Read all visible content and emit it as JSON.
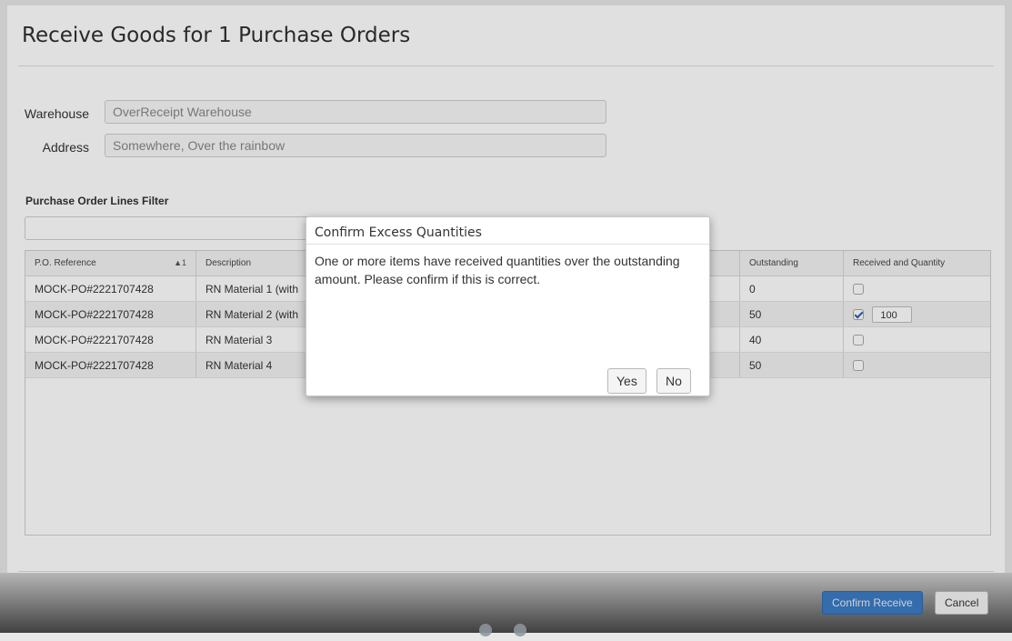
{
  "page": {
    "title": "Receive Goods for 1 Purchase Orders"
  },
  "form": {
    "warehouse_label": "Warehouse",
    "warehouse_value": "OverReceipt Warehouse",
    "address_label": "Address",
    "address_value": "Somewhere, Over the rainbow"
  },
  "filter": {
    "label": "Purchase Order Lines Filter",
    "value": ""
  },
  "grid": {
    "columns": {
      "reference": "P.O. Reference",
      "reference_sort": "▲1",
      "description": "Description",
      "outstanding": "Outstanding",
      "received": "Received and Quantity"
    },
    "rows": [
      {
        "reference": "MOCK-PO#2221707428",
        "description": "RN Material 1 (with",
        "outstanding": "0",
        "received": false,
        "quantity": ""
      },
      {
        "reference": "MOCK-PO#2221707428",
        "description": "RN Material 2 (with",
        "outstanding": "50",
        "received": true,
        "quantity": "100"
      },
      {
        "reference": "MOCK-PO#2221707428",
        "description": "RN Material 3",
        "outstanding": "40",
        "received": false,
        "quantity": ""
      },
      {
        "reference": "MOCK-PO#2221707428",
        "description": "RN Material 4",
        "outstanding": "50",
        "received": false,
        "quantity": ""
      }
    ]
  },
  "footer": {
    "confirm_label": "Confirm Receive",
    "cancel_label": "Cancel"
  },
  "modal": {
    "title": "Confirm Excess Quantities",
    "message": "One or more items have received quantities over the outstanding amount. Please confirm if this is correct.",
    "yes_label": "Yes",
    "no_label": "No"
  },
  "colors": {
    "primary": "#3c7cc4",
    "overlay": "rgba(0,0,0,0.12)"
  }
}
